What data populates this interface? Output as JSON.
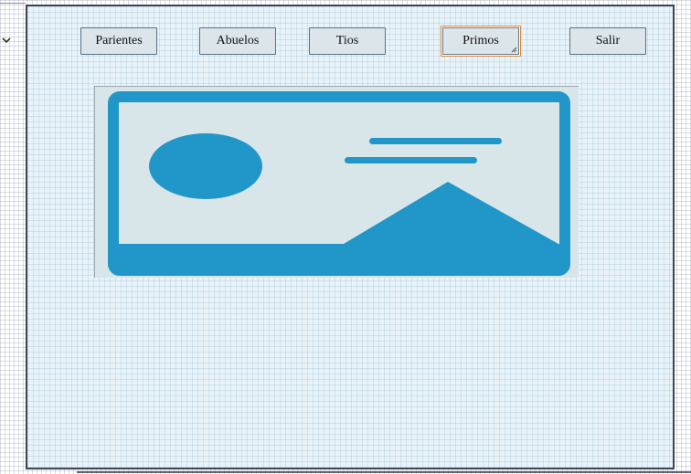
{
  "buttons": {
    "parientes": "Parientes",
    "abuelos": "Abuelos",
    "tios": "Tios",
    "primos": "Primos",
    "salir": "Salir"
  },
  "selected_button": "primos",
  "icons": {
    "expander": "chevron-down-icon",
    "image": "image-placeholder-icon",
    "resize": "resize-grip-icon"
  },
  "colors": {
    "form_border": "#3e4651",
    "button_bg": "#dbe5ea",
    "selection_border": "#d98a3a",
    "image_accent": "#2097c8",
    "image_bg": "#d8e6ea"
  }
}
